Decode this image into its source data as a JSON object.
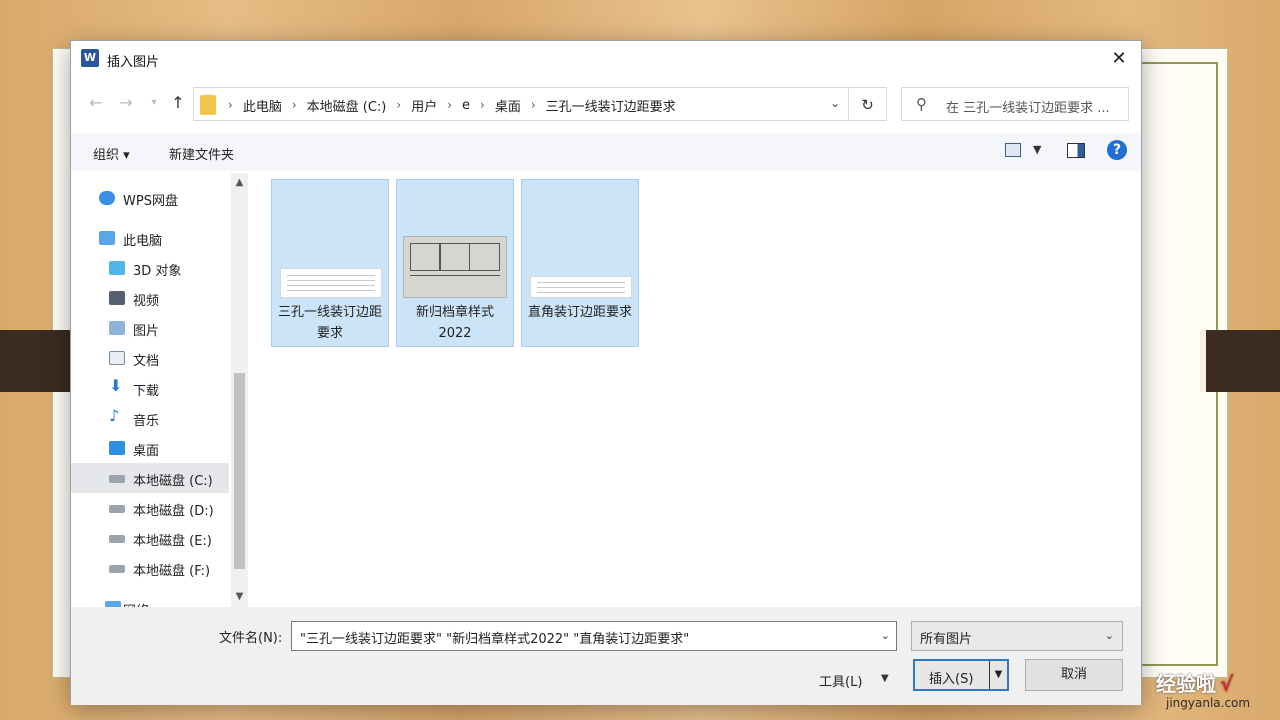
{
  "dialog": {
    "title": "插入图片",
    "close_glyph": "✕"
  },
  "address": {
    "breadcrumbs": [
      "此电脑",
      "本地磁盘 (C:)",
      "用户",
      "e",
      "桌面",
      "三孔一线装订边距要求"
    ],
    "search_placeholder": "在 三孔一线装订边距要求 ..."
  },
  "toolbar": {
    "organize": "组织 ▾",
    "new_folder": "新建文件夹"
  },
  "nav": {
    "items": [
      {
        "label": "WPS网盘",
        "icon": "cloud-icon"
      },
      {
        "label": "此电脑",
        "icon": "computer-icon"
      },
      {
        "label": "3D 对象",
        "icon": "cube-icon"
      },
      {
        "label": "视频",
        "icon": "video-icon"
      },
      {
        "label": "图片",
        "icon": "pictures-icon"
      },
      {
        "label": "文档",
        "icon": "document-icon"
      },
      {
        "label": "下载",
        "icon": "download-icon"
      },
      {
        "label": "音乐",
        "icon": "music-icon"
      },
      {
        "label": "桌面",
        "icon": "desktop-icon"
      },
      {
        "label": "本地磁盘 (C:)",
        "icon": "drive-icon"
      },
      {
        "label": "本地磁盘 (D:)",
        "icon": "drive-icon"
      },
      {
        "label": "本地磁盘 (E:)",
        "icon": "drive-icon"
      },
      {
        "label": "本地磁盘 (F:)",
        "icon": "drive-icon"
      },
      {
        "label": "网络",
        "icon": "network-icon"
      }
    ],
    "selected": "本地磁盘 (C:)"
  },
  "files": [
    {
      "name": "三孔一线装订边距要求",
      "selected": true
    },
    {
      "name": "新归档章样式2022",
      "selected": true
    },
    {
      "name": "直角装订边距要求",
      "selected": true
    }
  ],
  "bottom": {
    "filename_label": "文件名(N):",
    "filename_value": "\"三孔一线装订边距要求\" \"新归档章样式2022\" \"直角装订边距要求\"",
    "filter_value": "所有图片",
    "tools_label": "工具(L)",
    "insert_label": "插入(S)",
    "cancel_label": "取消"
  },
  "watermark": {
    "text": "经验啦",
    "check": "√",
    "url": "jingyanla.com"
  },
  "colors": {
    "selection": "#cce4f7",
    "accent": "#2e78c6",
    "help": "#1f6fd6"
  }
}
